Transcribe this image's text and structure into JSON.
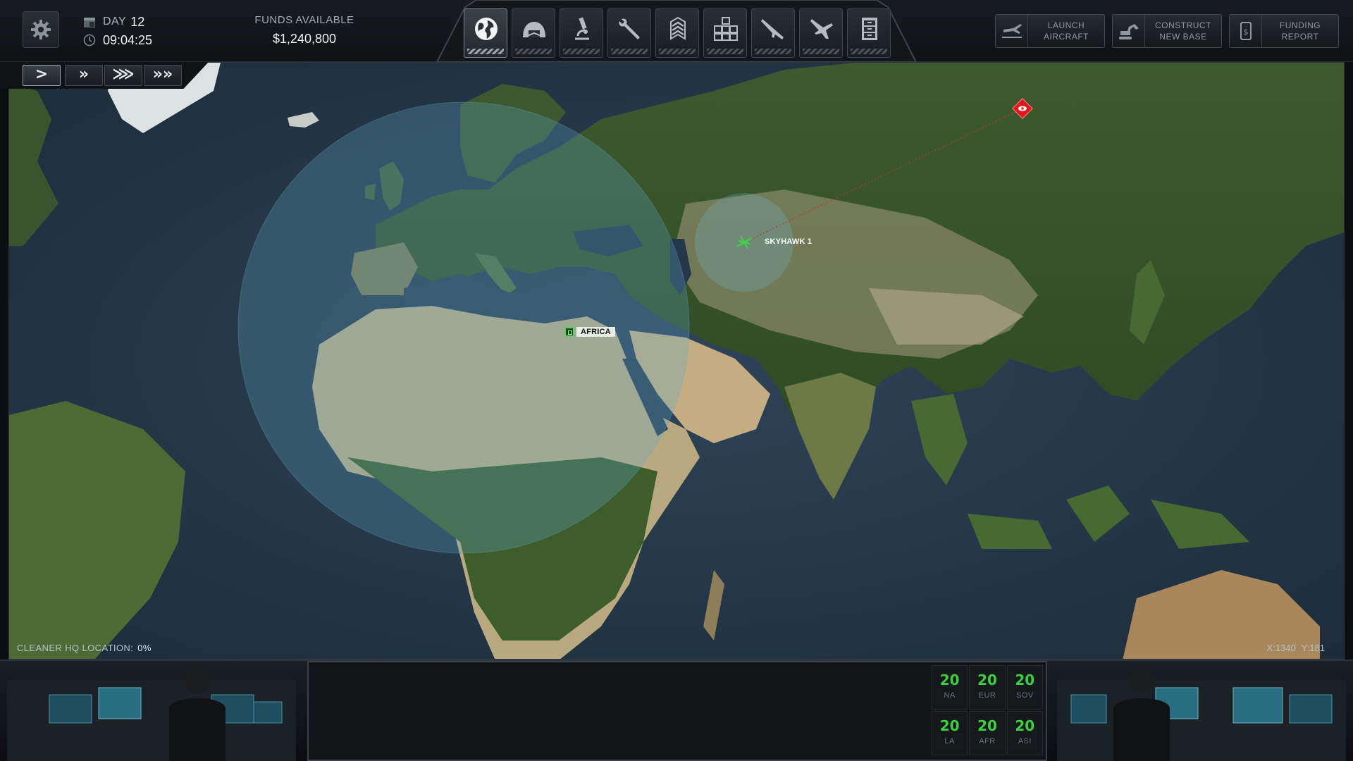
{
  "header": {
    "day_label": "DAY",
    "day_value": "12",
    "time": "09:04:25",
    "funds_label": "FUNDS AVAILABLE",
    "funds_value": "$1,240,800"
  },
  "tabs": [
    {
      "name": "geoscape-tab",
      "icon": "globe-icon",
      "active": true
    },
    {
      "name": "hangar-tab",
      "icon": "hangar-icon",
      "active": false
    },
    {
      "name": "research-tab",
      "icon": "microscope-icon",
      "active": false
    },
    {
      "name": "engineering-tab",
      "icon": "wrench-icon",
      "active": false
    },
    {
      "name": "soldiers-tab",
      "icon": "rank-chevron-icon",
      "active": false
    },
    {
      "name": "base-tab",
      "icon": "facility-grid-icon",
      "active": false
    },
    {
      "name": "armory-tab",
      "icon": "rifle-icon",
      "active": false
    },
    {
      "name": "aircraft-tab",
      "icon": "jet-icon",
      "active": false
    },
    {
      "name": "archives-tab",
      "icon": "file-cabinet-icon",
      "active": false
    }
  ],
  "actions": {
    "launch": "LAUNCH\nAIRCRAFT",
    "construct": "CONSTRUCT\nNEW BASE",
    "funding": "FUNDING\nREPORT"
  },
  "speed_buttons": [
    ">",
    "»",
    "⋙",
    "»»"
  ],
  "map": {
    "aircraft_label": "SKYHAWK 1",
    "base_label": "AFRICA",
    "hq_label": "CLEANER HQ LOCATION:",
    "hq_value": "0%",
    "coord_x": "X:1340",
    "coord_y": "Y:181",
    "colors": {
      "radar": "#5fa8c8",
      "aircraft": "#3fd04a",
      "ufo": "#e0161c",
      "base": "#5ad35a"
    }
  },
  "panic": {
    "values": [
      "20",
      "20",
      "20",
      "20",
      "20",
      "20"
    ],
    "regions": [
      "NA",
      "EUR",
      "SOV",
      "LA",
      "AFR",
      "ASI"
    ]
  }
}
